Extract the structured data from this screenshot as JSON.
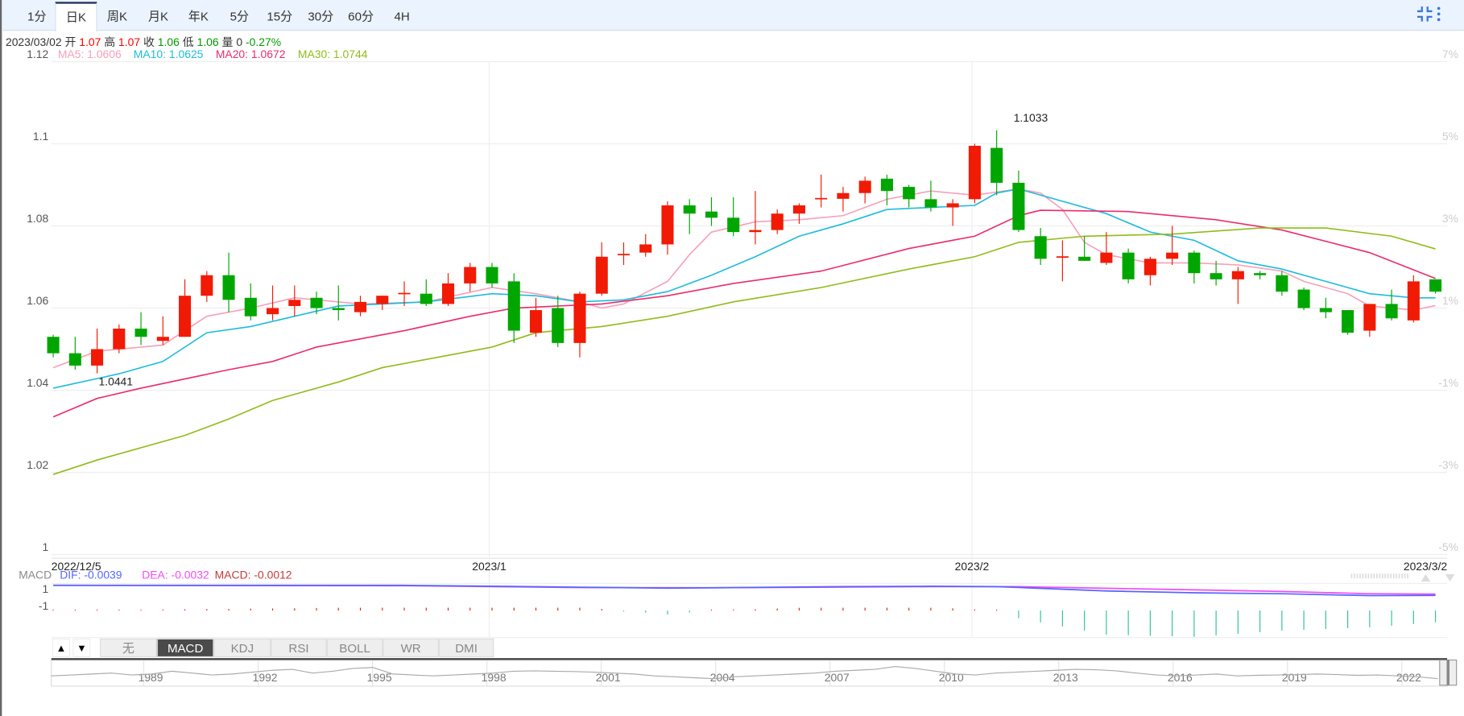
{
  "tabs": [
    "1分",
    "日K",
    "周K",
    "月K",
    "年K",
    "5分",
    "15分",
    "30分",
    "60分",
    "4H"
  ],
  "active_tab": 1,
  "toolbar": {
    "collapse_icon": "collapse-icon",
    "menu_icon": "more-vertical-icon"
  },
  "info": {
    "date": "2023/03/02",
    "open_label": "开",
    "open": "1.07",
    "high_label": "高",
    "high": "1.07",
    "close_label": "收",
    "close": "1.06",
    "low_label": "低",
    "low": "1.06",
    "volume_label": "量",
    "volume": "0",
    "change": "-0.27%"
  },
  "ma_legend": {
    "ma5": "MA5: 1.0606",
    "ma10": "MA10: 1.0625",
    "ma20": "MA20: 1.0672",
    "ma30": "MA30: 1.0744"
  },
  "macd_legend": {
    "title": "MACD",
    "dif": "DIF: -0.0039",
    "dea": "DEA: -0.0032",
    "macd": "MACD: -0.0012"
  },
  "macd_axis": [
    "1",
    "-1"
  ],
  "indicator_tabs": [
    "无",
    "MACD",
    "KDJ",
    "RSI",
    "BOLL",
    "WR",
    "DMI"
  ],
  "active_indicator": 1,
  "arrows": {
    "up": "▲",
    "down": "▼"
  },
  "navigator": {
    "years": [
      "1989",
      "1992",
      "1995",
      "1998",
      "2001",
      "2004",
      "2007",
      "2010",
      "2013",
      "2016",
      "2019",
      "2022"
    ],
    "series": [
      0.45,
      0.5,
      0.55,
      0.6,
      0.5,
      0.55,
      0.7,
      0.6,
      0.5,
      0.55,
      0.65,
      0.75,
      0.8,
      0.6,
      0.7,
      0.85,
      0.9,
      0.55,
      0.5,
      0.45,
      0.5,
      0.55,
      0.6,
      0.7,
      0.72,
      0.7,
      0.68,
      0.65,
      0.6,
      0.55,
      0.45,
      0.4,
      0.35,
      0.3,
      0.4,
      0.45,
      0.5,
      0.55,
      0.6,
      0.7,
      0.75,
      0.8,
      0.95,
      0.85,
      0.7,
      0.55,
      0.5,
      0.6,
      0.65,
      0.7,
      0.75,
      0.8,
      0.78,
      0.72,
      0.6,
      0.5,
      0.45,
      0.5,
      0.55,
      0.45,
      0.48,
      0.5,
      0.52,
      0.55,
      0.52,
      0.48,
      0.5,
      0.45,
      0.4,
      0.3
    ]
  },
  "colors": {
    "up": "#f11a04",
    "down": "#00a600",
    "ma5": "#f7a0b8",
    "ma10": "#1ebcdc",
    "ma20": "#eb2c6b",
    "ma30": "#8fbc1a",
    "dif": "#5466ff",
    "dea": "#f04cf6",
    "macd": "#c23a3c",
    "hist_down": "#2ec48f",
    "hist_up": "#e0201a"
  },
  "chart_data": {
    "type": "candlestick",
    "title": "",
    "ylim": [
      1.0,
      1.12
    ],
    "yticks": [
      "1.12",
      "1.1",
      "1.08",
      "1.06",
      "1.04",
      "1.02",
      "1"
    ],
    "ytick_values": [
      1.12,
      1.1,
      1.08,
      1.06,
      1.04,
      1.02,
      1.0
    ],
    "right_ticks": [
      "7%",
      "5%",
      "3%",
      "1%",
      "-1%",
      "-3%",
      "-5%"
    ],
    "xtick_labels": [
      {
        "label": "2022/12/5",
        "index": 0
      },
      {
        "label": "2023/1",
        "index": 20
      },
      {
        "label": "2023/2",
        "index": 42
      },
      {
        "label": "2023/3/2",
        "index": 63
      }
    ],
    "annotations": [
      {
        "label": "1.1033",
        "index": 44,
        "value": 1.1033
      },
      {
        "label": "1.0441",
        "index": 2,
        "value": 1.0441
      }
    ],
    "candles": [
      [
        1.053,
        1.0535,
        1.048,
        1.049
      ],
      [
        1.049,
        1.053,
        1.045,
        1.046
      ],
      [
        1.046,
        1.055,
        1.0441,
        1.05
      ],
      [
        1.05,
        1.056,
        1.049,
        1.055
      ],
      [
        1.055,
        1.059,
        1.051,
        1.053
      ],
      [
        1.052,
        1.058,
        1.051,
        1.053
      ],
      [
        1.053,
        1.067,
        1.053,
        1.063
      ],
      [
        1.063,
        1.069,
        1.0615,
        1.068
      ],
      [
        1.068,
        1.0735,
        1.059,
        1.062
      ],
      [
        1.0625,
        1.066,
        1.057,
        1.058
      ],
      [
        1.0585,
        1.0655,
        1.057,
        1.06
      ],
      [
        1.0605,
        1.0655,
        1.058,
        1.062
      ],
      [
        1.0625,
        1.064,
        1.0585,
        1.06
      ],
      [
        1.06,
        1.0655,
        1.057,
        1.0595
      ],
      [
        1.059,
        1.063,
        1.058,
        1.0615
      ],
      [
        1.061,
        1.063,
        1.0595,
        1.063
      ],
      [
        1.0635,
        1.0665,
        1.0605,
        1.0637
      ],
      [
        1.0635,
        1.067,
        1.0605,
        1.061
      ],
      [
        1.061,
        1.0685,
        1.0605,
        1.066
      ],
      [
        1.066,
        1.071,
        1.064,
        1.07
      ],
      [
        1.07,
        1.071,
        1.065,
        1.066
      ],
      [
        1.0665,
        1.0685,
        1.0515,
        1.0545
      ],
      [
        1.054,
        1.0625,
        1.053,
        1.0595
      ],
      [
        1.06,
        1.063,
        1.0505,
        1.0515
      ],
      [
        1.0515,
        1.064,
        1.048,
        1.0635
      ],
      [
        1.0635,
        1.076,
        1.063,
        1.0725
      ],
      [
        1.073,
        1.076,
        1.0705,
        1.0732
      ],
      [
        1.0735,
        1.078,
        1.0725,
        1.0755
      ],
      [
        1.0755,
        1.086,
        1.073,
        1.085
      ],
      [
        1.085,
        1.0865,
        1.078,
        1.083
      ],
      [
        1.0835,
        1.087,
        1.08,
        1.082
      ],
      [
        1.082,
        1.087,
        1.0775,
        1.0785
      ],
      [
        1.0785,
        1.0885,
        1.0755,
        1.079
      ],
      [
        1.079,
        1.084,
        1.078,
        1.083
      ],
      [
        1.083,
        1.0855,
        1.0805,
        1.085
      ],
      [
        1.0865,
        1.0925,
        1.0845,
        1.0868
      ],
      [
        1.0866,
        1.0895,
        1.0835,
        1.088
      ],
      [
        1.088,
        1.092,
        1.0855,
        1.091
      ],
      [
        1.0915,
        1.0925,
        1.085,
        1.0885
      ],
      [
        1.0895,
        1.09,
        1.0845,
        1.0865
      ],
      [
        1.0865,
        1.091,
        1.0835,
        1.0845
      ],
      [
        1.0845,
        1.0865,
        1.08,
        1.0855
      ],
      [
        1.0865,
        1.1,
        1.0855,
        1.0995
      ],
      [
        1.099,
        1.1033,
        1.0875,
        1.0905
      ],
      [
        1.0905,
        1.0935,
        1.0785,
        1.079
      ],
      [
        1.0775,
        1.0795,
        1.0705,
        1.072
      ],
      [
        1.0724,
        1.0765,
        1.0665,
        1.0726
      ],
      [
        1.0725,
        1.0775,
        1.0715,
        1.0715
      ],
      [
        1.071,
        1.0785,
        1.0705,
        1.0735
      ],
      [
        1.0735,
        1.0745,
        1.066,
        1.067
      ],
      [
        1.068,
        1.0725,
        1.0655,
        1.072
      ],
      [
        1.072,
        1.08,
        1.0705,
        1.0735
      ],
      [
        1.0735,
        1.074,
        1.066,
        1.0685
      ],
      [
        1.0685,
        1.0715,
        1.0655,
        1.067
      ],
      [
        1.067,
        1.07,
        1.061,
        1.069
      ],
      [
        1.0685,
        1.069,
        1.067,
        1.068
      ],
      [
        1.068,
        1.069,
        1.063,
        1.064
      ],
      [
        1.0645,
        1.065,
        1.0595,
        1.06
      ],
      [
        1.06,
        1.0625,
        1.0575,
        1.059
      ],
      [
        1.0595,
        1.0595,
        1.0535,
        1.054
      ],
      [
        1.0545,
        1.061,
        1.053,
        1.061
      ],
      [
        1.061,
        1.0645,
        1.057,
        1.0575
      ],
      [
        1.057,
        1.068,
        1.0565,
        1.0665
      ],
      [
        1.067,
        1.067,
        1.0635,
        1.064
      ]
    ],
    "candle_format": [
      "open",
      "high",
      "low",
      "close"
    ],
    "series": [
      {
        "name": "MA5",
        "points": [
          [
            0,
            1.0455
          ],
          [
            2,
            1.0495
          ],
          [
            5,
            1.051
          ],
          [
            7,
            1.058
          ],
          [
            9,
            1.06
          ],
          [
            11,
            1.0625
          ],
          [
            14,
            1.061
          ],
          [
            17,
            1.0615
          ],
          [
            20,
            1.065
          ],
          [
            22,
            1.0635
          ],
          [
            24,
            1.0615
          ],
          [
            25,
            1.06
          ],
          [
            26,
            1.061
          ],
          [
            28,
            1.0665
          ],
          [
            29,
            1.073
          ],
          [
            30,
            1.0785
          ],
          [
            32,
            1.081
          ],
          [
            34,
            1.0815
          ],
          [
            36,
            1.0825
          ],
          [
            38,
            1.0865
          ],
          [
            40,
            1.0885
          ],
          [
            42,
            1.0875
          ],
          [
            44,
            1.089
          ],
          [
            45,
            1.088
          ],
          [
            46,
            1.084
          ],
          [
            47,
            1.076
          ],
          [
            48,
            1.073
          ],
          [
            50,
            1.071
          ],
          [
            52,
            1.071
          ],
          [
            54,
            1.0705
          ],
          [
            56,
            1.069
          ],
          [
            57,
            1.0665
          ],
          [
            59,
            1.0635
          ],
          [
            60,
            1.0605
          ],
          [
            62,
            1.0595
          ],
          [
            63,
            1.0606
          ]
        ]
      },
      {
        "name": "MA10",
        "points": [
          [
            0,
            1.0405
          ],
          [
            3,
            1.044
          ],
          [
            5,
            1.047
          ],
          [
            7,
            1.054
          ],
          [
            9,
            1.0555
          ],
          [
            11,
            1.058
          ],
          [
            13,
            1.0605
          ],
          [
            15,
            1.061
          ],
          [
            17,
            1.0615
          ],
          [
            20,
            1.0635
          ],
          [
            22,
            1.063
          ],
          [
            24,
            1.0615
          ],
          [
            26,
            1.062
          ],
          [
            28,
            1.064
          ],
          [
            30,
            1.068
          ],
          [
            32,
            1.0725
          ],
          [
            34,
            1.0775
          ],
          [
            36,
            1.0805
          ],
          [
            38,
            1.084
          ],
          [
            40,
            1.0845
          ],
          [
            42,
            1.085
          ],
          [
            43,
            1.088
          ],
          [
            44,
            1.089
          ],
          [
            45,
            1.0875
          ],
          [
            48,
            1.083
          ],
          [
            50,
            1.0785
          ],
          [
            52,
            1.0765
          ],
          [
            54,
            1.0715
          ],
          [
            56,
            1.0695
          ],
          [
            58,
            1.0665
          ],
          [
            60,
            1.0635
          ],
          [
            62,
            1.0625
          ],
          [
            63,
            1.0625
          ]
        ]
      },
      {
        "name": "MA20",
        "points": [
          [
            0,
            1.0335
          ],
          [
            2,
            1.038
          ],
          [
            4,
            1.0405
          ],
          [
            8,
            1.045
          ],
          [
            10,
            1.047
          ],
          [
            12,
            1.0505
          ],
          [
            16,
            1.0545
          ],
          [
            19,
            1.058
          ],
          [
            21,
            1.06
          ],
          [
            25,
            1.061
          ],
          [
            28,
            1.063
          ],
          [
            31,
            1.066
          ],
          [
            35,
            1.069
          ],
          [
            39,
            1.0745
          ],
          [
            41,
            1.0765
          ],
          [
            42,
            1.0775
          ],
          [
            44,
            1.0825
          ],
          [
            45,
            1.0838
          ],
          [
            49,
            1.0835
          ],
          [
            53,
            1.0815
          ],
          [
            56,
            1.079
          ],
          [
            60,
            1.0735
          ],
          [
            63,
            1.0672
          ]
        ]
      },
      {
        "name": "MA30",
        "points": [
          [
            0,
            1.0195
          ],
          [
            2,
            1.023
          ],
          [
            6,
            1.029
          ],
          [
            8,
            1.033
          ],
          [
            10,
            1.0375
          ],
          [
            13,
            1.042
          ],
          [
            15,
            1.0455
          ],
          [
            18,
            1.0485
          ],
          [
            20,
            1.0505
          ],
          [
            22,
            1.054
          ],
          [
            25,
            1.0555
          ],
          [
            28,
            1.058
          ],
          [
            31,
            1.0615
          ],
          [
            35,
            1.065
          ],
          [
            39,
            1.0695
          ],
          [
            42,
            1.0725
          ],
          [
            44,
            1.076
          ],
          [
            47,
            1.0775
          ],
          [
            51,
            1.078
          ],
          [
            55,
            1.0795
          ],
          [
            58,
            1.0795
          ],
          [
            61,
            1.0775
          ],
          [
            63,
            1.0744
          ]
        ]
      }
    ],
    "macd": {
      "dif": [
        [
          0,
          0.0015
        ],
        [
          16,
          0.0015
        ],
        [
          24,
          0.0005
        ],
        [
          28,
          0.0
        ],
        [
          36,
          0.0008
        ],
        [
          40,
          0.001
        ],
        [
          43,
          0.0008
        ],
        [
          48,
          -0.0015
        ],
        [
          52,
          -0.0025
        ],
        [
          56,
          -0.003
        ],
        [
          60,
          -0.004
        ],
        [
          63,
          -0.0039
        ]
      ],
      "dea": [
        [
          0,
          0.0015
        ],
        [
          16,
          0.0013
        ],
        [
          24,
          0.0003
        ],
        [
          30,
          0.0002
        ],
        [
          40,
          0.0008
        ],
        [
          44,
          0.0008
        ],
        [
          50,
          -0.0005
        ],
        [
          56,
          -0.0018
        ],
        [
          60,
          -0.003
        ],
        [
          63,
          -0.0032
        ]
      ]
    }
  }
}
